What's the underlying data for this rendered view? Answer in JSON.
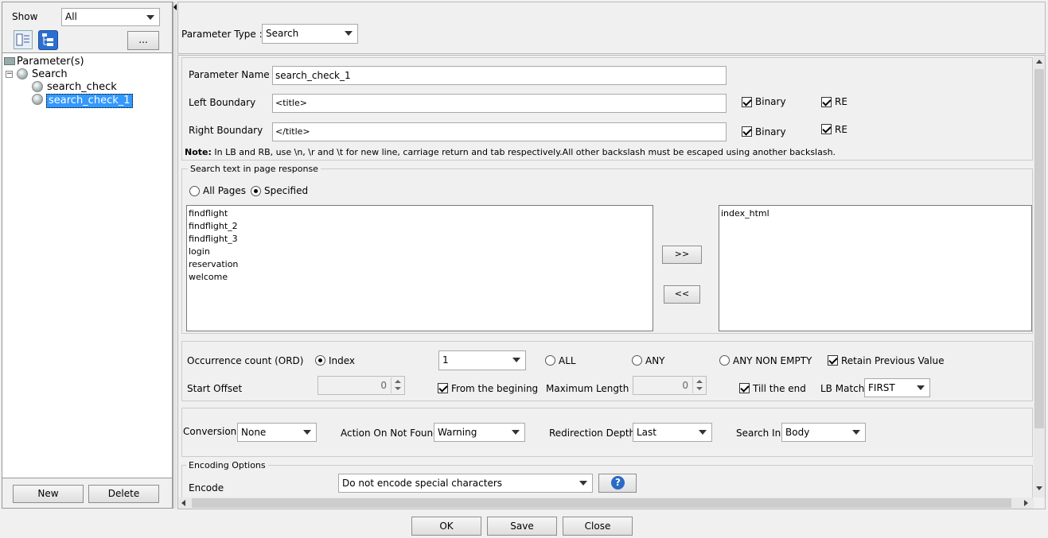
{
  "left": {
    "show_label": "Show",
    "show_value": "All",
    "more_button": "...",
    "tree": {
      "root": "Parameter(s)",
      "group": "Search",
      "items": [
        "search_check",
        "search_check_1"
      ]
    },
    "new_button": "New",
    "delete_button": "Delete"
  },
  "top": {
    "param_type_label": "Parameter Type :",
    "param_type_value": "Search"
  },
  "form": {
    "param_name_label": "Parameter Name",
    "param_name_value": "search_check_1",
    "left_boundary_label": "Left Boundary",
    "left_boundary_value": "<title>",
    "right_boundary_label": "Right Boundary",
    "right_boundary_value": "</title>",
    "binary_label": "Binary",
    "re_label": "RE",
    "note_bold": "Note:",
    "note_text": " In LB and RB, use \\n, \\r and \\t for new line, carriage return and tab respectively.All other backslash must be escaped using another backslash."
  },
  "search_text": {
    "title": "Search text in page response",
    "all_pages": "All Pages",
    "specified": "Specified",
    "available": [
      "findflight",
      "findflight_2",
      "findflight_3",
      "login",
      "reservation",
      "welcome"
    ],
    "selected": [
      "index_html"
    ],
    "add_button": ">>",
    "remove_button": "<<"
  },
  "occurrence": {
    "label": "Occurrence count (ORD)",
    "index_label": "Index",
    "index_value": "1",
    "all_label": "ALL",
    "any_label": "ANY",
    "any_non_empty_label": "ANY NON EMPTY",
    "retain_label": "Retain Previous Value",
    "start_offset_label": "Start Offset",
    "start_offset_value": "0",
    "from_beginning_label": "From the begining",
    "max_length_label": "Maximum Length",
    "max_length_value": "0",
    "till_end_label": "Till the end",
    "lb_match_label": "LB Match",
    "lb_match_value": "FIRST"
  },
  "options": {
    "conversion_label": "Conversion",
    "conversion_value": "None",
    "action_label": "Action On Not Found",
    "action_value": "Warning",
    "redirection_label": "Redirection Depth",
    "redirection_value": "Last",
    "search_in_label": "Search In",
    "search_in_value": "Body"
  },
  "encoding": {
    "title": "Encoding Options",
    "encode_label": "Encode",
    "encode_value": "Do not encode special characters",
    "help_glyph": "?"
  },
  "footer": {
    "ok": "OK",
    "save": "Save",
    "close": "Close"
  }
}
